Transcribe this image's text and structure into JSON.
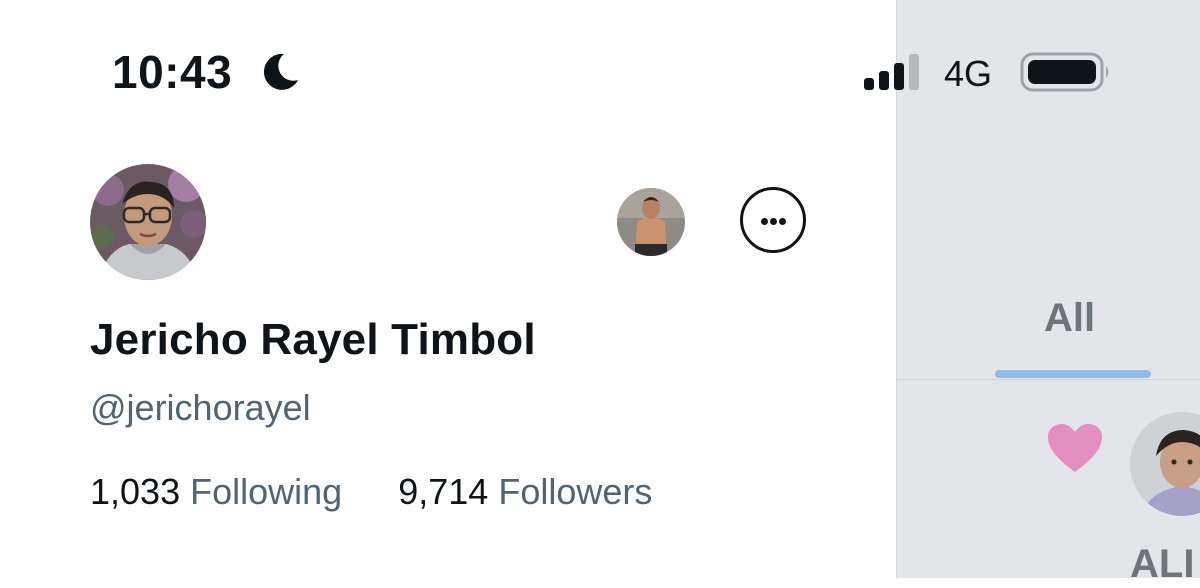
{
  "status_bar": {
    "time": "10:43",
    "focus_icon": "moon-icon",
    "signal_icon": "cellular-signal-icon",
    "network": "4G",
    "battery_icon": "battery-icon"
  },
  "profile": {
    "avatar_icon": "profile-avatar",
    "switch_account_avatar": "secondary-account-avatar",
    "more_icon": "more-options-icon",
    "display_name": "Jericho Rayel Timbol",
    "handle": "@jerichorayel",
    "following_count": "1,033",
    "following_label": "Following",
    "followers_count": "9,714",
    "followers_label": "Followers"
  },
  "notifications_panel": {
    "tab_label": "All",
    "like_icon": "heart-icon",
    "notif_name_partial": "ALI"
  },
  "colors": {
    "text_primary": "#0f1419",
    "text_secondary": "#536471",
    "panel_bg": "#e3e5e8",
    "tab_underline": "#8fbde6",
    "heart": "#e38fbf"
  }
}
